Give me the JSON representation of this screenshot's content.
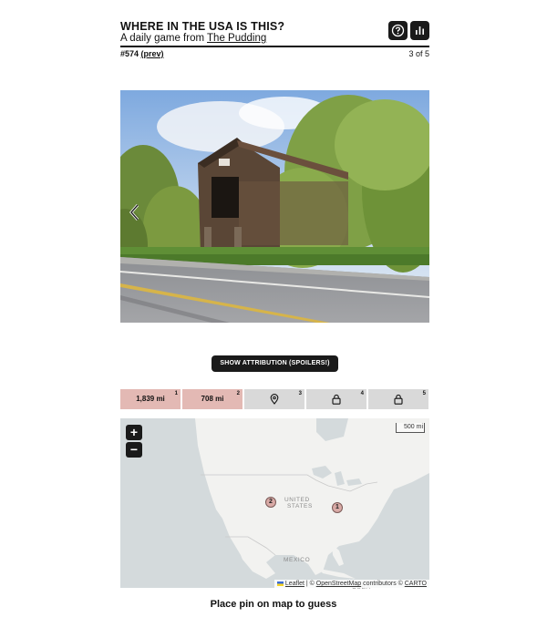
{
  "header": {
    "title": "WHERE IN THE USA IS THIS?",
    "subtitle_prefix": "A daily game from ",
    "subtitle_link": "The Pudding",
    "help_icon": "help-circle-icon",
    "stats_icon": "bar-chart-icon"
  },
  "subbar": {
    "puzzle_number": "#574",
    "prev_link": "(prev)",
    "pagination": "3 of 5"
  },
  "photo": {
    "prev_icon": "chevron-left-icon"
  },
  "attribution_button": "SHOW ATTRIBUTION (SPOILERS!)",
  "guesses": [
    {
      "index": "1",
      "value": "1,839 mi",
      "state": "missed",
      "color": "#e3b9b4"
    },
    {
      "index": "2",
      "value": "708 mi",
      "state": "missed",
      "color": "#e3b9b4"
    },
    {
      "index": "3",
      "value": "",
      "state": "current",
      "icon": "map-pin-icon",
      "color": "#d9d9d9"
    },
    {
      "index": "4",
      "value": "",
      "state": "locked",
      "icon": "lock-icon",
      "color": "#d9d9d9"
    },
    {
      "index": "5",
      "value": "",
      "state": "locked",
      "icon": "lock-icon",
      "color": "#d9d9d9"
    }
  ],
  "map": {
    "zoom_in": "+",
    "zoom_out": "−",
    "scale": "500 mi",
    "labels": {
      "us_line1": "UNITED",
      "us_line2": "STATES",
      "mexico": "MEXICO",
      "cuba": "CUBA"
    },
    "markers": [
      {
        "label": "1"
      },
      {
        "label": "2"
      }
    ],
    "credits": {
      "leaflet": "Leaflet",
      "sep": " | © ",
      "osm": "OpenStreetMap",
      "contrib": " contributors © ",
      "carto": "CARTO"
    }
  },
  "footer": "Place pin on map to guess"
}
